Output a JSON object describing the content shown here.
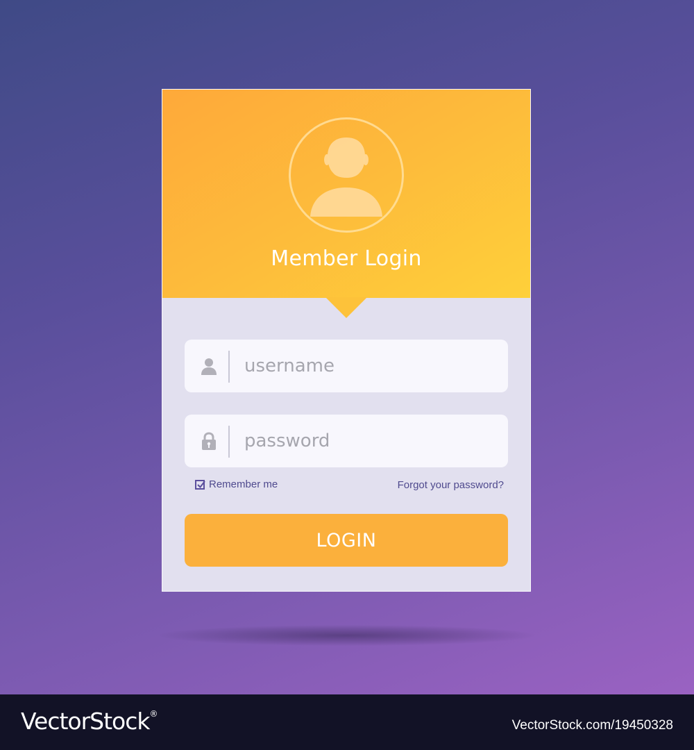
{
  "login_card": {
    "title": "Member Login",
    "username_placeholder": "username",
    "password_placeholder": "password",
    "remember_label": "Remember me",
    "remember_checked": true,
    "forgot_label": "Forgot your password?",
    "login_label": "LOGIN"
  },
  "icons": {
    "avatar": "user-avatar-icon",
    "username": "user-icon",
    "password": "lock-icon",
    "checkbox": "check-icon"
  },
  "colors": {
    "header_gradient_start": "#fea93a",
    "header_gradient_end": "#fed03a",
    "card_body": "#e2e0ef",
    "button": "#fbb03c",
    "link_text": "#4f4a8e",
    "background_start": "#3f4a86",
    "background_end": "#9a62c2"
  },
  "watermark": {
    "logo_text": "VectorStock",
    "logo_mark": "®",
    "image_id": "VectorStock.com/19450328"
  }
}
